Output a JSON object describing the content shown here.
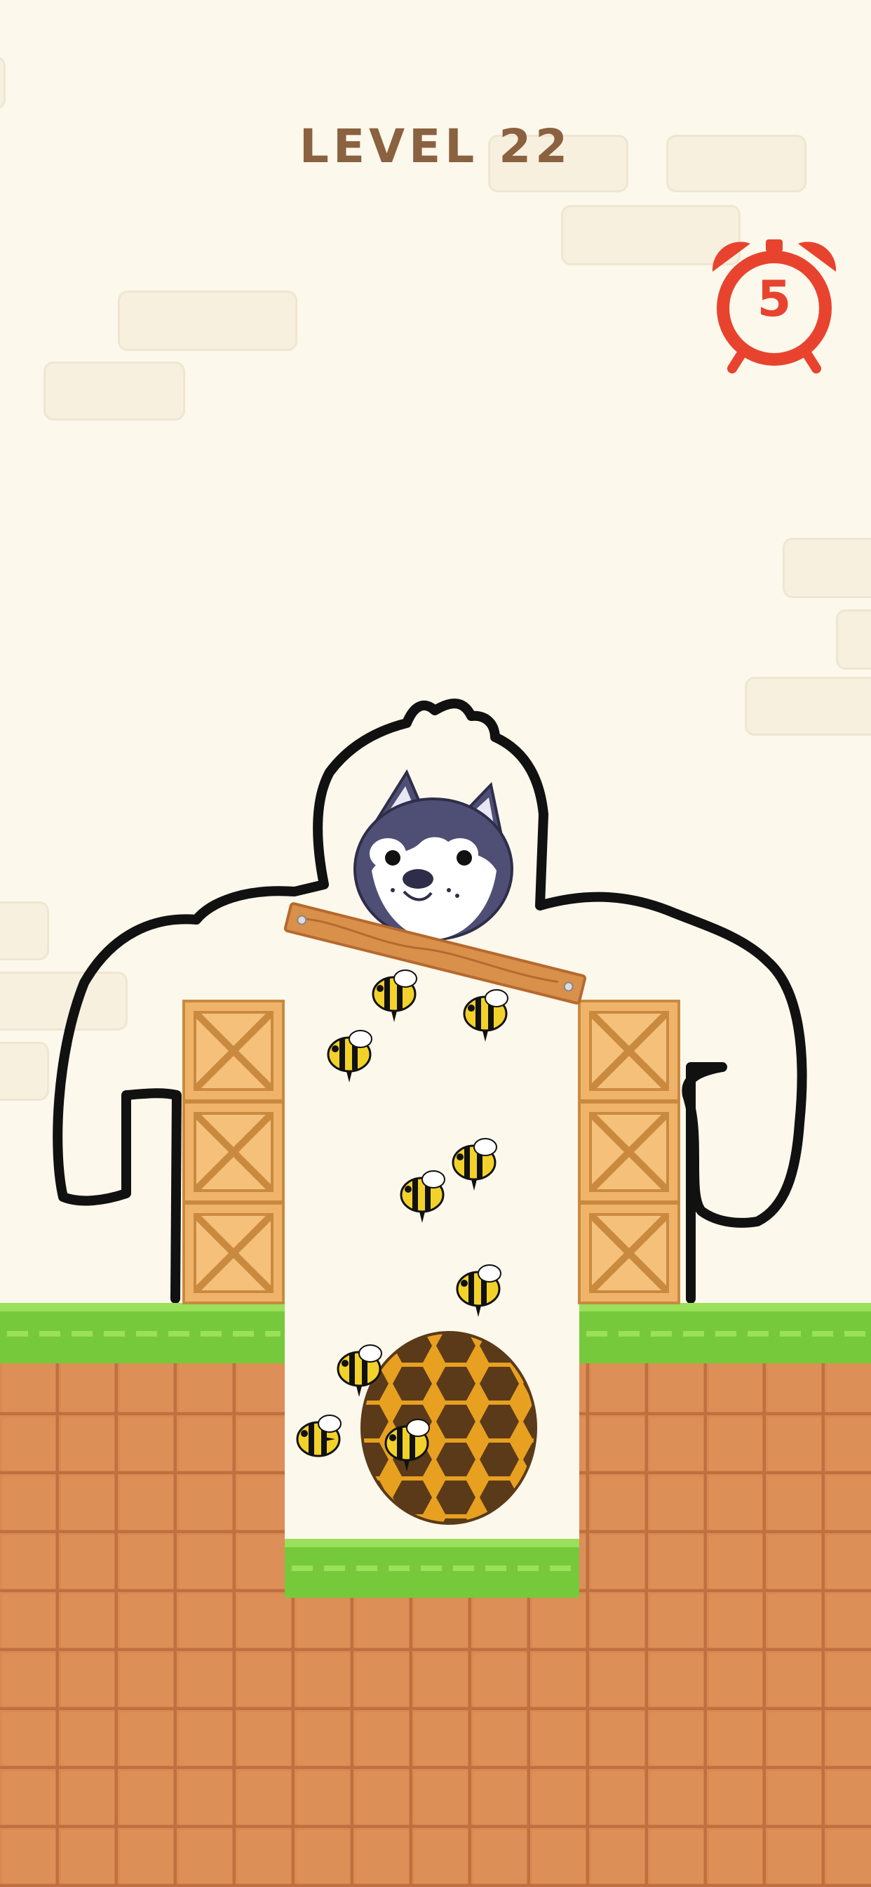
{
  "header": {
    "level_label": "LEVEL 22"
  },
  "timer": {
    "value": "5",
    "icon": "alarm-clock-icon",
    "color": "#e8432e"
  },
  "scene": {
    "character": "husky-dog",
    "hazard": "beehive",
    "bee_count": 10,
    "draw_outline": "black-hand-drawn-line",
    "plank": "wooden-plank",
    "crates": 6
  },
  "colors": {
    "background": "#fdf8ec",
    "title": "#8a6240",
    "grass": "#7ccc3c",
    "dirt": "#d9894f",
    "crate": "#efb46a"
  }
}
